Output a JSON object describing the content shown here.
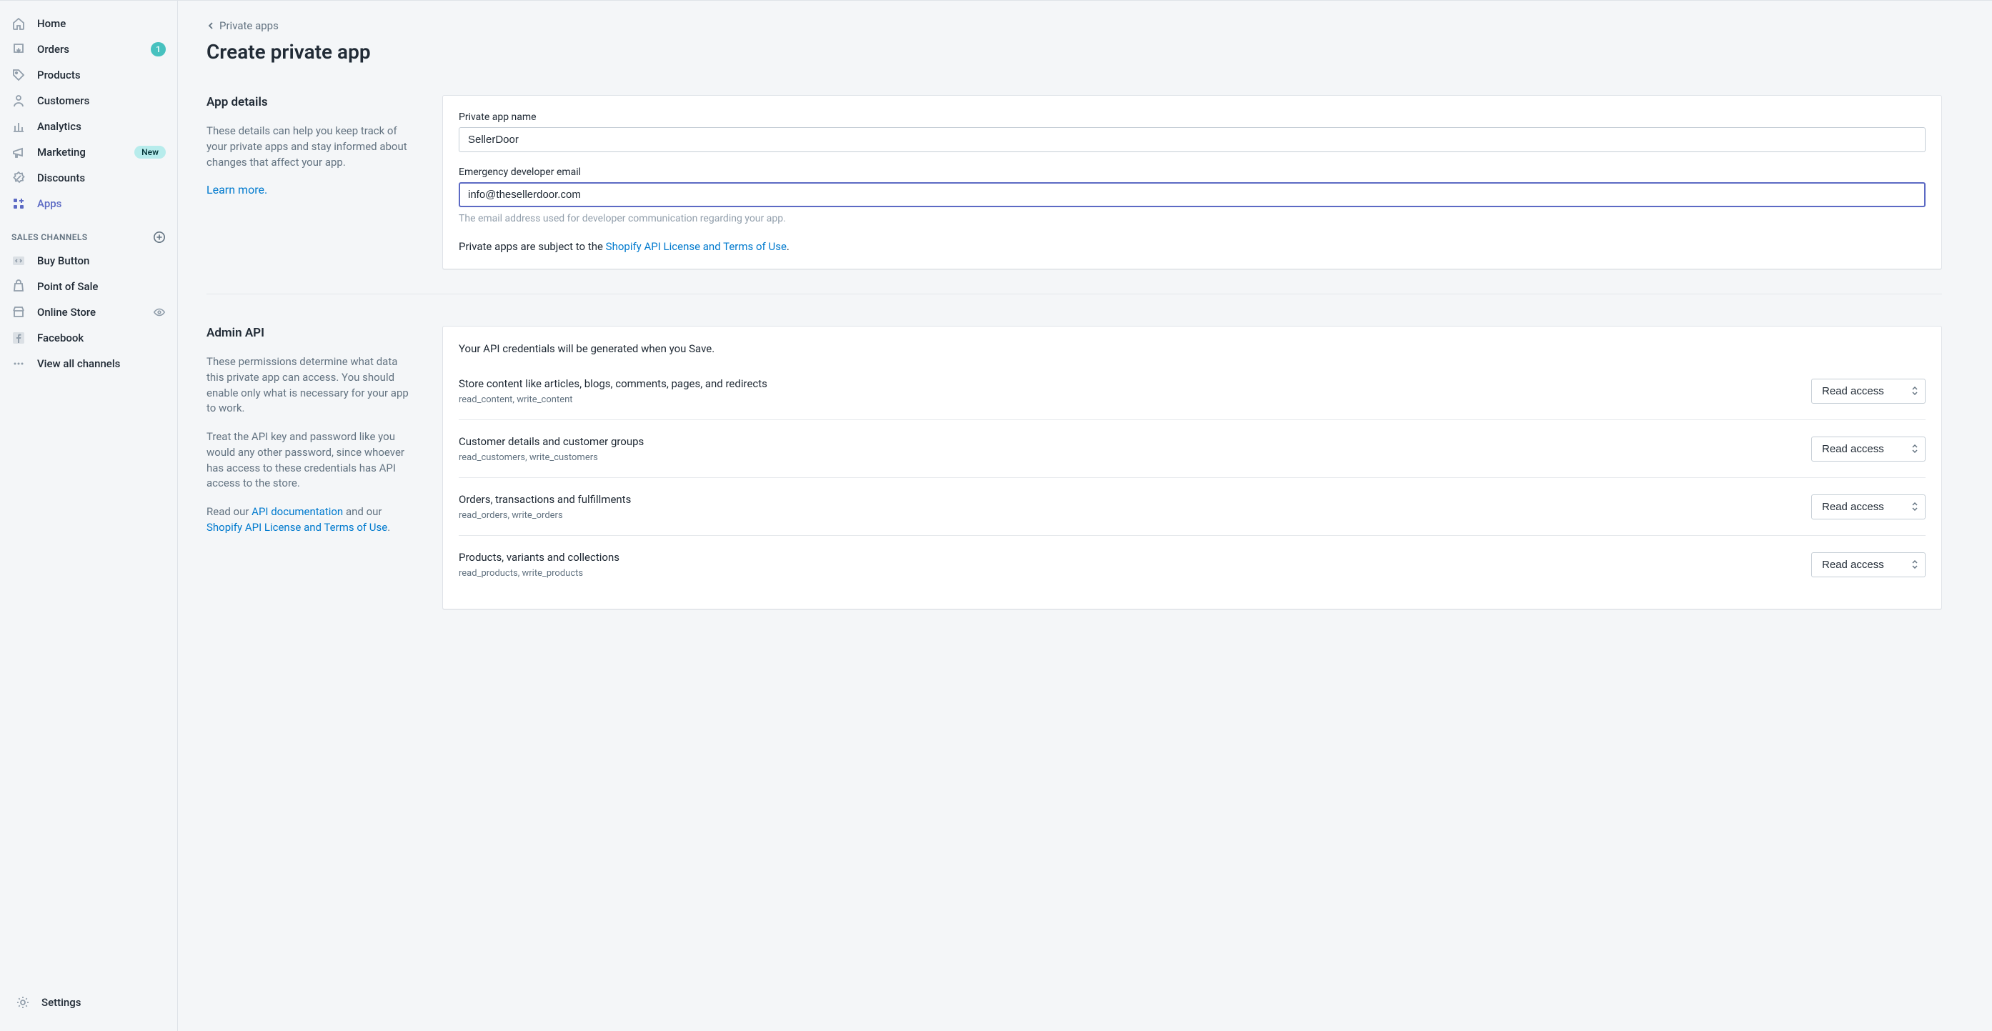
{
  "sidebar": {
    "nav": [
      {
        "label": "Home"
      },
      {
        "label": "Orders",
        "badge": "1"
      },
      {
        "label": "Products"
      },
      {
        "label": "Customers"
      },
      {
        "label": "Analytics"
      },
      {
        "label": "Marketing",
        "tag": "New"
      },
      {
        "label": "Discounts"
      },
      {
        "label": "Apps"
      }
    ],
    "channels_header": "SALES CHANNELS",
    "channels": [
      {
        "label": "Buy Button"
      },
      {
        "label": "Point of Sale"
      },
      {
        "label": "Online Store"
      },
      {
        "label": "Facebook"
      }
    ],
    "view_all": "View all channels",
    "settings": "Settings"
  },
  "breadcrumb": "Private apps",
  "page_title": "Create private app",
  "app_details": {
    "heading": "App details",
    "desc": "These details can help you keep track of your private apps and stay informed about changes that affect your app.",
    "learn_more": "Learn more.",
    "name_label": "Private app name",
    "name_value": "SellerDoor",
    "email_label": "Emergency developer email",
    "email_value": "info@thesellerdoor.com",
    "email_help": "The email address used for developer communication regarding your app.",
    "notice_before": "Private apps are subject to the ",
    "notice_link": "Shopify API License and Terms of Use",
    "notice_after": "."
  },
  "admin_api": {
    "heading": "Admin API",
    "desc1": "These permissions determine what data this private app can access. You should enable only what is necessary for your app to work.",
    "desc2": "Treat the API key and password like you would any other password, since whoever has access to these credentials has API access to the store.",
    "desc3_before": "Read our ",
    "desc3_link1": "API documentation",
    "desc3_mid": " and our ",
    "desc3_link2": "Shopify API License and Terms of Use",
    "desc3_after": ".",
    "generated_note": "Your API credentials will be generated when you Save.",
    "permissions": [
      {
        "title": "Store content like articles, blogs, comments, pages, and redirects",
        "scopes": "read_content, write_content",
        "value": "Read access"
      },
      {
        "title": "Customer details and customer groups",
        "scopes": "read_customers, write_customers",
        "value": "Read access"
      },
      {
        "title": "Orders, transactions and fulfillments",
        "scopes": "read_orders, write_orders",
        "value": "Read access"
      },
      {
        "title": "Products, variants and collections",
        "scopes": "read_products, write_products",
        "value": "Read access"
      }
    ]
  }
}
